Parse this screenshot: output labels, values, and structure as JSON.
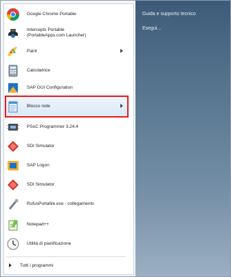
{
  "menu": {
    "items": [
      {
        "label": "Google Chrome Portable",
        "icon": "chrome-icon",
        "has_submenu": false
      },
      {
        "label": "Intercepts Portable\n(PortableApps.com Launcher)",
        "icon": "portable-app-icon",
        "has_submenu": false
      },
      {
        "label": "Paint",
        "icon": "paint-icon",
        "has_submenu": true
      },
      {
        "label": "Calcolatrice",
        "icon": "calculator-icon",
        "has_submenu": false
      },
      {
        "label": "SAP GUI Configuration",
        "icon": "sap-gui-config-icon",
        "has_submenu": false
      },
      {
        "label": "Blocco note",
        "icon": "notepad-icon",
        "has_submenu": true
      },
      {
        "label": "PSoC Programmer 3.24.4",
        "icon": "psoc-programmer-icon",
        "has_submenu": false
      },
      {
        "label": "SDI Simulator",
        "icon": "sdi-simulator-icon",
        "has_submenu": false
      },
      {
        "label": "SAP Logon",
        "icon": "sap-logon-icon",
        "has_submenu": false
      },
      {
        "label": "SDI Simulator",
        "icon": "sdi-simulator-icon",
        "has_submenu": false
      },
      {
        "label": "RufusPortable.exe - collegamento",
        "icon": "shortcut-icon",
        "has_submenu": false
      },
      {
        "label": "Notepad++",
        "icon": "notepadpp-icon",
        "has_submenu": false
      },
      {
        "label": "Utilità di pianificazione",
        "icon": "task-scheduler-icon",
        "has_submenu": false
      }
    ],
    "all_programs_label": "Tutti i programmi"
  },
  "right_pane": {
    "help_label": "Guida e supporto tecnico",
    "more_label": "Esegui..."
  },
  "colors": {
    "highlight": "#e31b1b",
    "right_pane_top": "#3d5b78",
    "right_pane_bottom": "#9db0c2"
  }
}
